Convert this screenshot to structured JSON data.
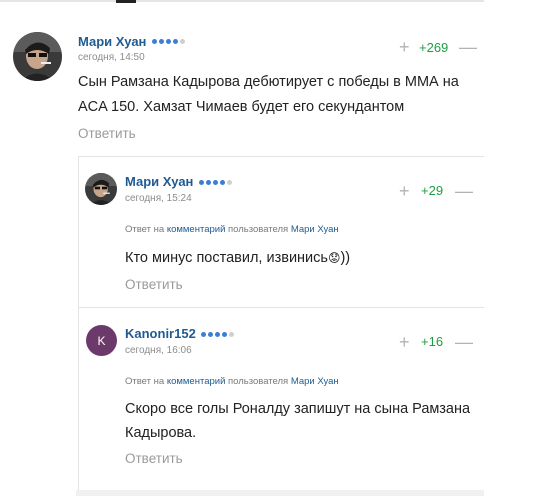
{
  "comments": [
    {
      "author": "Мари Хуан",
      "time": "сегодня, 14:50",
      "score": "+269",
      "text_line1": "Сын Рамзана Кадырова дебютирует с победы в ММА на",
      "text_line2": "ACA 150. Хамзат Чимаев будет его секундантом",
      "answer_label": "Ответить",
      "rating_dots": 4
    },
    {
      "author": "Мари Хуан",
      "time": "сегодня, 15:24",
      "score": "+29",
      "reply_prefix": "Ответ на",
      "reply_link": "комментарий",
      "reply_middle": "пользователя",
      "reply_user": "Мари Хуан",
      "text": "Кто минус поставил, извинись",
      "text_suffix": "))",
      "emoji": "😟",
      "answer_label": "Ответить",
      "rating_dots": 4
    },
    {
      "author": "Kanonir152",
      "avatar_letter": "K",
      "time": "сегодня, 16:06",
      "score": "+16",
      "reply_prefix": "Ответ на",
      "reply_link": "комментарий",
      "reply_middle": "пользователя",
      "reply_user": "Мари Хуан",
      "text_line1": "Скоро все голы Роналду запишут на сына Рамзана",
      "text_line2": "Кадырова.",
      "answer_label": "Ответить",
      "rating_dots": 4
    }
  ],
  "vote": {
    "plus": "+",
    "minus": "—"
  }
}
